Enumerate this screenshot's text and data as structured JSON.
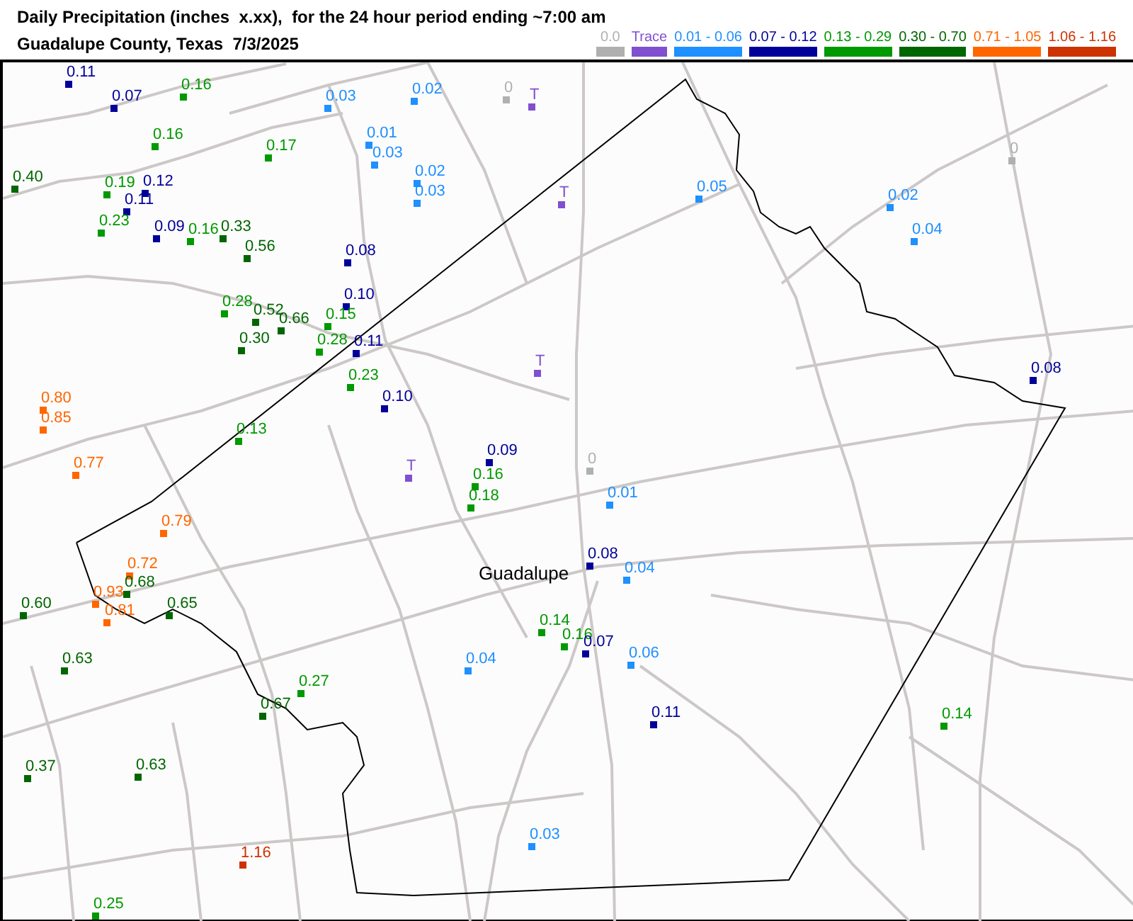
{
  "header": {
    "title": "Daily Precipitation (inches  x.xx),  for the 24 hour period ending ~7:00 am",
    "subtitle": "Guadalupe County, Texas  7/3/2025"
  },
  "legend": [
    {
      "label": "0.0",
      "color": "#b0b0b0"
    },
    {
      "label": "Trace",
      "color": "#8050d0"
    },
    {
      "label": "0.01 - 0.06",
      "color": "#1e90ff"
    },
    {
      "label": "0.07 - 0.12",
      "color": "#000099"
    },
    {
      "label": "0.13 - 0.29",
      "color": "#009900"
    },
    {
      "label": "0.30 - 0.70",
      "color": "#006600"
    },
    {
      "label": "0.71 - 1.05",
      "color": "#ff6600"
    },
    {
      "label": "1.06 - 1.16",
      "color": "#cc3300"
    }
  ],
  "map": {
    "place_label": "Guadalupe",
    "stations": [
      {
        "value": "0.11",
        "color": "#000099"
      },
      {
        "value": "0.07",
        "color": "#000099"
      },
      {
        "value": "0.16",
        "color": "#009900"
      },
      {
        "value": "0.16",
        "color": "#009900"
      },
      {
        "value": "0.17",
        "color": "#009900"
      },
      {
        "value": "0.03",
        "color": "#1e90ff"
      },
      {
        "value": "0.01",
        "color": "#1e90ff"
      },
      {
        "value": "0.03",
        "color": "#1e90ff"
      },
      {
        "value": "0.40",
        "color": "#006600"
      },
      {
        "value": "0.19",
        "color": "#009900"
      },
      {
        "value": "0.12",
        "color": "#000099"
      },
      {
        "value": "0.11",
        "color": "#000099"
      },
      {
        "value": "0.23",
        "color": "#009900"
      },
      {
        "value": "0.09",
        "color": "#000099"
      },
      {
        "value": "0.16",
        "color": "#009900"
      },
      {
        "value": "0.33",
        "color": "#006600"
      },
      {
        "value": "0.56",
        "color": "#006600"
      },
      {
        "value": "0.08",
        "color": "#000099"
      },
      {
        "value": "0.10",
        "color": "#000099"
      },
      {
        "value": "0.28",
        "color": "#009900"
      },
      {
        "value": "0.52",
        "color": "#006600"
      },
      {
        "value": "0.66",
        "color": "#006600"
      },
      {
        "value": "0.15",
        "color": "#009900"
      },
      {
        "value": "0.30",
        "color": "#006600"
      },
      {
        "value": "0.28",
        "color": "#009900"
      },
      {
        "value": "0.11",
        "color": "#000099"
      },
      {
        "value": "0.23",
        "color": "#009900"
      },
      {
        "value": "0.10",
        "color": "#000099"
      },
      {
        "value": "0.80",
        "color": "#ff6600"
      },
      {
        "value": "0.85",
        "color": "#ff6600"
      },
      {
        "value": "0.13",
        "color": "#009900"
      },
      {
        "value": "0.77",
        "color": "#ff6600"
      },
      {
        "value": "0.79",
        "color": "#ff6600"
      },
      {
        "value": "0.72",
        "color": "#ff6600"
      },
      {
        "value": "0.68",
        "color": "#006600"
      },
      {
        "value": "0.93",
        "color": "#ff6600"
      },
      {
        "value": "0.81",
        "color": "#ff6600"
      },
      {
        "value": "0.60",
        "color": "#006600"
      },
      {
        "value": "0.65",
        "color": "#006600"
      },
      {
        "value": "0.63",
        "color": "#006600"
      },
      {
        "value": "0.27",
        "color": "#009900"
      },
      {
        "value": "0.67",
        "color": "#006600"
      },
      {
        "value": "0.37",
        "color": "#006600"
      },
      {
        "value": "0.63",
        "color": "#006600"
      },
      {
        "value": "1.16",
        "color": "#cc3300"
      },
      {
        "value": "0.25",
        "color": "#009900"
      },
      {
        "value": "0.02",
        "color": "#1e90ff"
      },
      {
        "value": "0",
        "color": "#b0b0b0"
      },
      {
        "value": "T",
        "color": "#8050d0"
      },
      {
        "value": "0.02",
        "color": "#1e90ff"
      },
      {
        "value": "0.03",
        "color": "#1e90ff"
      },
      {
        "value": "T",
        "color": "#8050d0"
      },
      {
        "value": "0.05",
        "color": "#1e90ff"
      },
      {
        "value": "0.02",
        "color": "#1e90ff"
      },
      {
        "value": "0.04",
        "color": "#1e90ff"
      },
      {
        "value": "0",
        "color": "#b0b0b0"
      },
      {
        "value": "T",
        "color": "#8050d0"
      },
      {
        "value": "0.08",
        "color": "#000099"
      },
      {
        "value": "T",
        "color": "#8050d0"
      },
      {
        "value": "0.09",
        "color": "#000099"
      },
      {
        "value": "0.16",
        "color": "#009900"
      },
      {
        "value": "0.18",
        "color": "#009900"
      },
      {
        "value": "0",
        "color": "#b0b0b0"
      },
      {
        "value": "0.01",
        "color": "#1e90ff"
      },
      {
        "value": "0.08",
        "color": "#000099"
      },
      {
        "value": "0.04",
        "color": "#1e90ff"
      },
      {
        "value": "0.14",
        "color": "#009900"
      },
      {
        "value": "0.16",
        "color": "#009900"
      },
      {
        "value": "0.07",
        "color": "#000099"
      },
      {
        "value": "0.04",
        "color": "#1e90ff"
      },
      {
        "value": "0.06",
        "color": "#1e90ff"
      },
      {
        "value": "0.11",
        "color": "#000099"
      },
      {
        "value": "0.03",
        "color": "#1e90ff"
      },
      {
        "value": "0.14",
        "color": "#009900"
      }
    ]
  }
}
